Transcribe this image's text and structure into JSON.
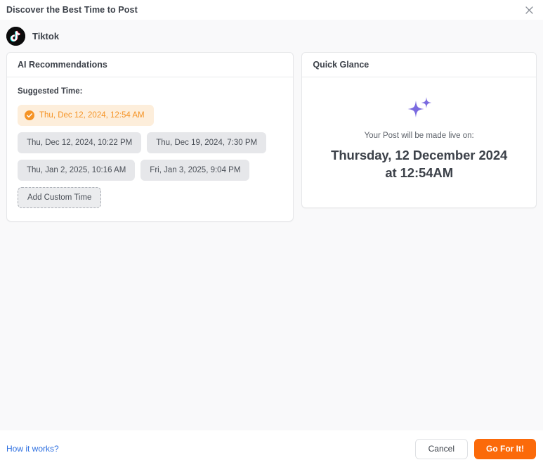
{
  "header": {
    "title": "Discover the Best Time to Post",
    "close_icon": "close-icon"
  },
  "account": {
    "platform_icon": "tiktok-icon",
    "name": "Tiktok"
  },
  "ai_panel": {
    "title": "AI Recommendations",
    "section_label": "Suggested Time:",
    "selected_icon": "check-circle-icon",
    "times": [
      {
        "label": "Thu, Dec 12, 2024, 12:54 AM",
        "selected": true
      },
      {
        "label": "Thu, Dec 12, 2024, 10:22 PM",
        "selected": false
      },
      {
        "label": "Thu, Dec 19, 2024, 7:30 PM",
        "selected": false
      },
      {
        "label": "Thu, Jan 2, 2025, 10:16 AM",
        "selected": false
      },
      {
        "label": "Fri, Jan 3, 2025, 9:04 PM",
        "selected": false
      }
    ],
    "add_custom_label": "Add Custom Time"
  },
  "quick_glance": {
    "title": "Quick Glance",
    "sparkle_icon": "sparkles-icon",
    "caption": "Your Post will be made live on:",
    "date_line_1": "Thursday, 12 December 2024",
    "date_line_2": "at 12:54AM"
  },
  "footer": {
    "how_it_works": "How it works?",
    "cancel_label": "Cancel",
    "confirm_label": "Go For It!"
  },
  "colors": {
    "accent_orange": "#fb6a0a",
    "chip_selected_bg": "#fdeedb",
    "chip_selected_text": "#f59324",
    "link_blue": "#2d6fe0",
    "sparkle_purple": "#7b6be0",
    "page_bg": "#f9f9fa"
  }
}
